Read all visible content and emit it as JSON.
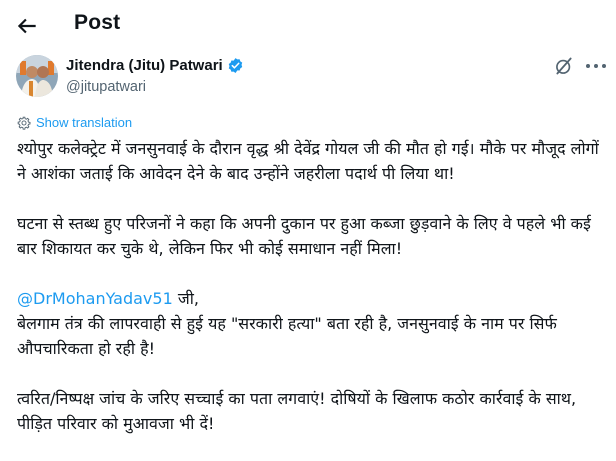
{
  "header": {
    "back_icon": "arrow-left-icon",
    "title": "Post"
  },
  "author": {
    "name": "Jitendra (Jitu) Patwari",
    "handle": "@jitupatwari",
    "verified_color": "#1d9bf0"
  },
  "translate": {
    "label": "Show translation",
    "icon": "gear-icon"
  },
  "post": {
    "p1": "श्योपुर कलेक्ट्रेट में जनसुनवाई के दौरान वृद्ध श्री देवेंद्र गोयल जी की मौत हो गई। मौके पर मौजूद लोगों ने आशंका जताई कि आवेदन देने के बाद उन्होंने जहरीला पदार्थ पी लिया था!",
    "p2": "घटना से स्तब्ध हुए परिजनों ने कहा कि अपनी दुकान पर हुआ कब्जा छुड़वाने के लिए वे पहले भी कई बार शिकायत कर चुके थे, लेकिन फिर भी कोई समाधान नहीं मिला!",
    "mention": "@DrMohanYadav51",
    "mention_suffix": " जी,",
    "p3": "बेलगाम तंत्र की लापरवाही से हुई यह \"सरकारी हत्या\" बता रही है, जनसुनवाई के नाम पर सिर्फ औपचारिकता हो रही है!",
    "p4": "त्वरित/निष्पक्ष जांच के जरिए सच्चाई का पता लगवाएं! दोषियों के खिलाफ कठोर कार्रवाई के साथ, पीड़ित परिवार को मुआवजा भी दें!"
  },
  "colors": {
    "accent": "#1d9bf0",
    "text": "#0f1419",
    "secondary": "#536471"
  }
}
